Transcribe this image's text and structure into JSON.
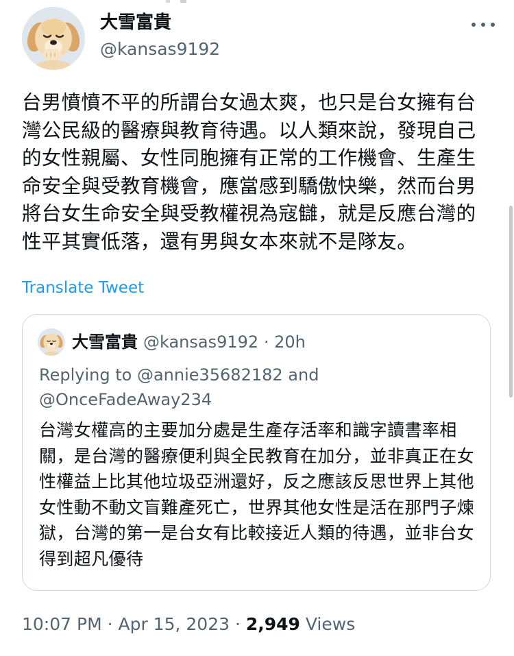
{
  "author": {
    "display_name": "大雪富貴",
    "handle": "@kansas9192",
    "avatar_icon": "golden-retriever-puppy-avatar"
  },
  "menu_icon": "more-horizontal-icon",
  "tweet": {
    "text": "台男憤憤不平的所謂台女過太爽，也只是台女擁有台灣公民級的醫療與教育待遇。以人類來說，發現自己的女性親屬、女性同胞擁有正常的工作機會、生產生命安全與受教育機會，應當感到驕傲快樂，然而台男將台女生命安全與受教權視為寇讎，就是反應台灣的性平其實低落，還有男與女本來就不是隊友。",
    "translate_label": "Translate Tweet"
  },
  "quote": {
    "display_name": "大雪富貴",
    "meta": "@kansas9192 · 20h",
    "replying_prefix": "Replying to ",
    "replying_to_1": "@annie35682182",
    "replying_and": " and ",
    "replying_to_2": "@OnceFadeAway234",
    "text": "台灣女權高的主要加分處是生產存活率和識字讀書率相關，是台灣的醫療便利與全民教育在加分，並非真正在女性權益上比其他垃圾亞洲還好，反之應該反思世界上其他女性動不動文盲難產死亡，世界其他女性是活在那門子煉獄，台灣的第一是台女有比較接近人類的待遇，並非台女得到超凡優待"
  },
  "footer": {
    "time": "10:07 PM",
    "separator": " · ",
    "date": "Apr 15, 2023",
    "separator2": " · ",
    "views_count": "2,949",
    "views_label": " Views"
  },
  "colors": {
    "text_primary": "#0f1419",
    "text_secondary": "#536471",
    "link": "#1d9bf0",
    "border": "#cfd9de"
  }
}
